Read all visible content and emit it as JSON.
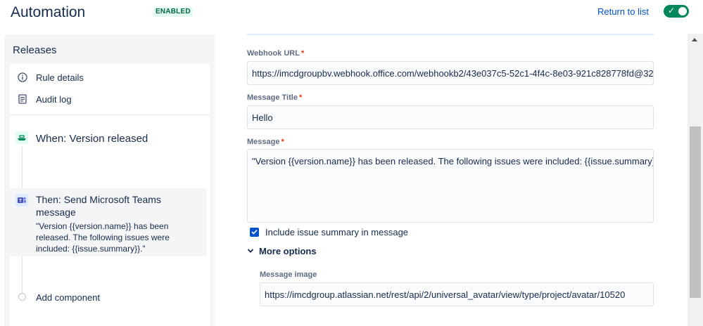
{
  "header": {
    "title": "Automation",
    "status_badge": "ENABLED",
    "return_link": "Return to list",
    "rule_enabled": true
  },
  "sidebar": {
    "title": "Releases",
    "nav": [
      {
        "label": "Rule details",
        "icon": "info-icon"
      },
      {
        "label": "Audit log",
        "icon": "document-icon"
      }
    ],
    "trigger": {
      "label": "When: Version released",
      "icon": "ship-icon"
    },
    "action": {
      "title": "Then: Send Microsoft Teams message",
      "description": "\"Version {{version.name}} has been released. The following issues were included: {{issue.summary}}.\"",
      "icon": "microsoft-teams-icon"
    },
    "add_component": "Add component"
  },
  "form": {
    "webhook_url": {
      "label": "Webhook URL",
      "required": "*",
      "value": "https://imcdgroupbv.webhook.office.com/webhookb2/43e037c5-52c1-4f4c-8e03-921c828778fd@32"
    },
    "message_title": {
      "label": "Message Title",
      "required": "*",
      "value": "Hello"
    },
    "message": {
      "label": "Message",
      "required": "*",
      "value": "\"Version {{version.name}} has been released. The following issues were included: {{issue.summary}}.\""
    },
    "include_summary": {
      "label": "Include issue summary in message",
      "checked": true
    },
    "more_options": "More options",
    "message_image": {
      "label": "Message image",
      "value": "https://imcdgroup.atlassian.net/rest/api/2/universal_avatar/view/type/project/avatar/10520"
    }
  },
  "colors": {
    "accent": "#0052cc",
    "enabled_green": "#00875a",
    "text": "#172b4d",
    "required": "#de350b"
  }
}
